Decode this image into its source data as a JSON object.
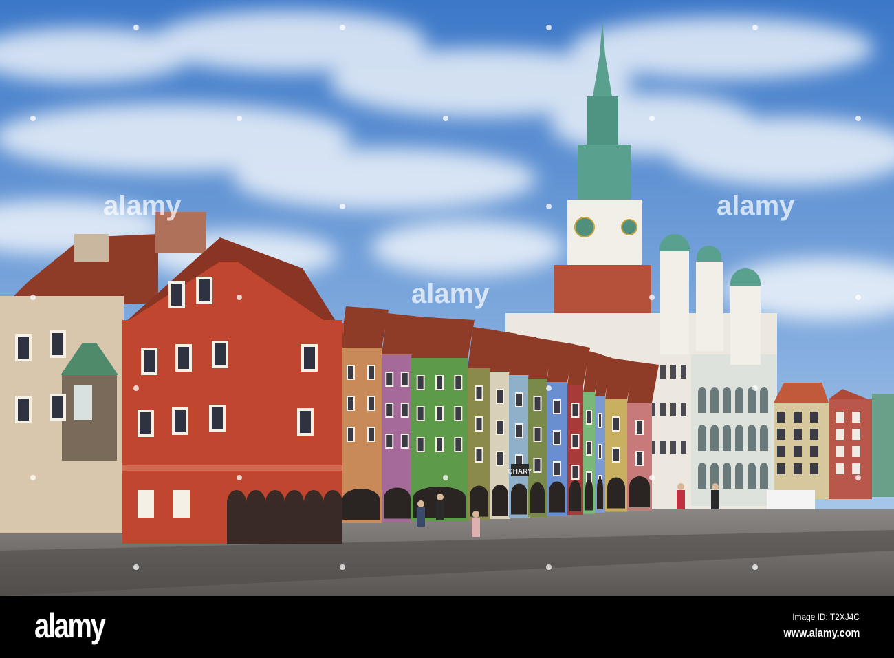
{
  "photo": {
    "subject": "Old Market Square with colorful merchant houses and Town Hall tower",
    "shop_sign": "CHARY",
    "colors": {
      "sky_top": "#3c78c8",
      "sky_bottom": "#a9c8ea",
      "cobblestone": "#6f6b69",
      "red_house": "#c0462f",
      "beige_house": "#d8c6ad",
      "town_hall": "#ece8e0",
      "tower_brick": "#b5513a",
      "copper_green": "#5aa08e"
    }
  },
  "watermark": {
    "text": "alamy"
  },
  "footer": {
    "logo": "alamy",
    "image_id": "Image ID: T2XJ4C",
    "url": "www.alamy.com"
  }
}
